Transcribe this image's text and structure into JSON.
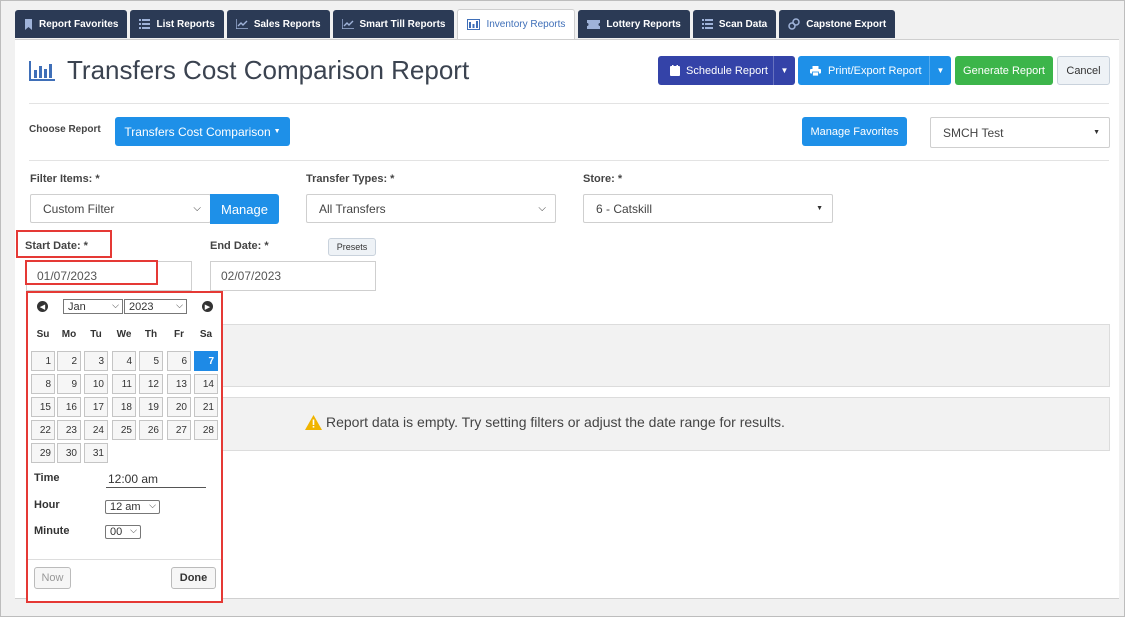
{
  "tabs": [
    {
      "label": "Report Favorites",
      "icon": "bookmark-icon"
    },
    {
      "label": "List Reports",
      "icon": "list-icon"
    },
    {
      "label": "Sales Reports",
      "icon": "line-chart-icon"
    },
    {
      "label": "Smart Till Reports",
      "icon": "line-chart-icon"
    },
    {
      "label": "Inventory Reports",
      "icon": "inventory-icon"
    },
    {
      "label": "Lottery Reports",
      "icon": "ticket-icon"
    },
    {
      "label": "Scan Data",
      "icon": "list-icon"
    },
    {
      "label": "Capstone Export",
      "icon": "link-icon"
    }
  ],
  "active_tab": "Inventory Reports",
  "header": {
    "title": "Transfers Cost Comparison Report",
    "schedule_label": "Schedule Report",
    "print_label": "Print/Export Report",
    "generate_label": "Generate Report",
    "cancel_label": "Cancel"
  },
  "choose": {
    "label": "Choose Report",
    "report_button": "Transfers Cost Comparison",
    "manage_favorites": "Manage Favorites",
    "store_select": "SMCH Test"
  },
  "filters": {
    "filter_items_label": "Filter Items: *",
    "filter_items_value": "Custom Filter",
    "manage_label": "Manage",
    "transfer_types_label": "Transfer Types: *",
    "transfer_types_value": "All Transfers",
    "store_label": "Store: *",
    "store_value": "6 - Catskill",
    "start_date_label": "Start Date: *",
    "start_date_value": "01/07/2023",
    "end_date_label": "End Date: *",
    "end_date_value": "02/07/2023",
    "presets_label": "Presets"
  },
  "message": "Report data is empty. Try setting filters or adjust the date range for results.",
  "calendar": {
    "month": "Jan",
    "year": "2023",
    "weekdays": [
      "Su",
      "Mo",
      "Tu",
      "We",
      "Th",
      "Fr",
      "Sa"
    ],
    "first_weekday_index": 0,
    "days_in_month": 31,
    "selected_day": 7,
    "time_label": "Time",
    "time_value": "12:00 am",
    "hour_label": "Hour",
    "hour_value": "12 am",
    "minute_label": "Minute",
    "minute_value": "00",
    "now_label": "Now",
    "done_label": "Done"
  },
  "colors": {
    "tab_bg": "#2b3a55",
    "primary_dark": "#3443a8",
    "primary_blue": "#1e90e8",
    "success": "#3cb54a",
    "highlight": "#e53935",
    "warning": "#f0b400"
  }
}
